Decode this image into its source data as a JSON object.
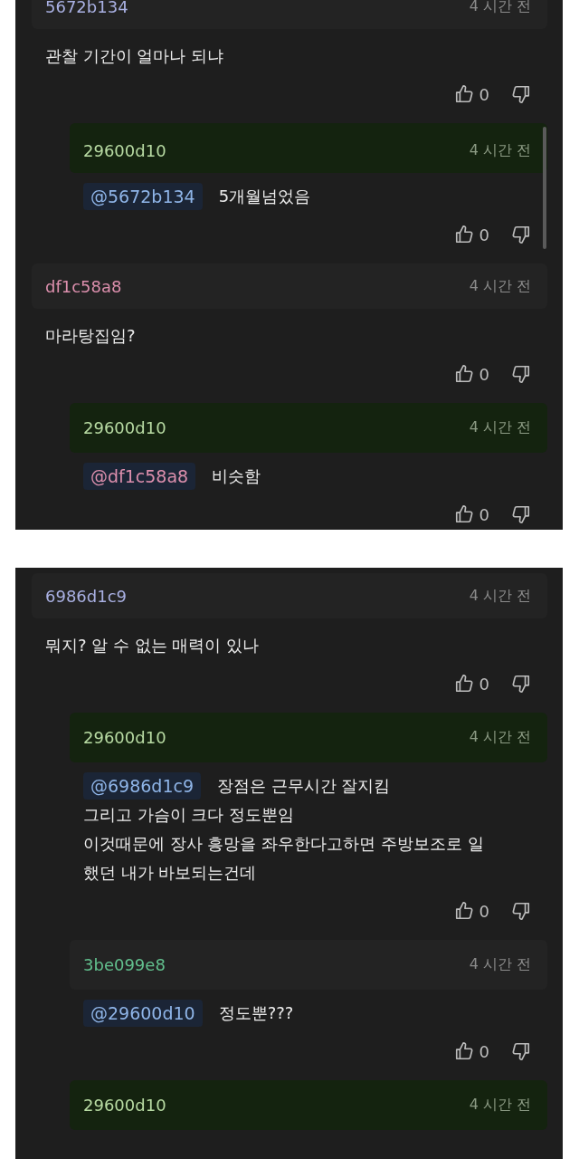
{
  "panels": [
    {
      "comments": [
        {
          "author": "5672b134",
          "color": "#a9b0e2",
          "time": "4 시간 전",
          "highlighted": false,
          "lines": [
            "관찰 기간이 얼마나 되냐"
          ],
          "likes": "0",
          "replies": [
            {
              "author": "29600d10",
              "color": "#b8dba3",
              "time": "4 시간 전",
              "highlighted": true,
              "mention": {
                "text": "@5672b134",
                "color": "#8fb5e8"
              },
              "lines": [
                "5개월넘었음"
              ],
              "likes": "0"
            }
          ]
        },
        {
          "author": "df1c58a8",
          "color": "#dc8fad",
          "time": "4 시간 전",
          "highlighted": false,
          "lines": [
            "마라탕집임?"
          ],
          "likes": "0",
          "replies": [
            {
              "author": "29600d10",
              "color": "#b8dba3",
              "time": "4 시간 전",
              "highlighted": true,
              "mention": {
                "text": "@df1c58a8",
                "color": "#dc8fad"
              },
              "lines": [
                "비슷함"
              ],
              "likes": "0"
            }
          ]
        }
      ]
    },
    {
      "comments": [
        {
          "author": "6986d1c9",
          "color": "#a9b0e2",
          "time": "4 시간 전",
          "highlighted": false,
          "lines": [
            "뭐지? 알 수 없는 매력이 있나"
          ],
          "likes": "0",
          "replies": [
            {
              "author": "29600d10",
              "color": "#b8dba3",
              "time": "4 시간 전",
              "highlighted": true,
              "mention": {
                "text": "@6986d1c9",
                "color": "#8fb5e8"
              },
              "lines": [
                "장점은 근무시간 잘지킴",
                "그리고 가슴이 크다 정도뿐임",
                "이것때문에 장사 흥망을 좌우한다고하면 주방보조로 일",
                "했던 내가 바보되는건데"
              ],
              "likes": "0"
            },
            {
              "author": "3be099e8",
              "color": "#62c08e",
              "time": "4 시간 전",
              "highlighted": false,
              "mention": {
                "text": "@29600d10",
                "color": "#8fb5e8"
              },
              "lines": [
                "정도뿐???"
              ],
              "likes": "0"
            },
            {
              "author": "29600d10",
              "color": "#b8dba3",
              "time": "4 시간 전",
              "highlighted": true
            }
          ]
        }
      ]
    }
  ]
}
